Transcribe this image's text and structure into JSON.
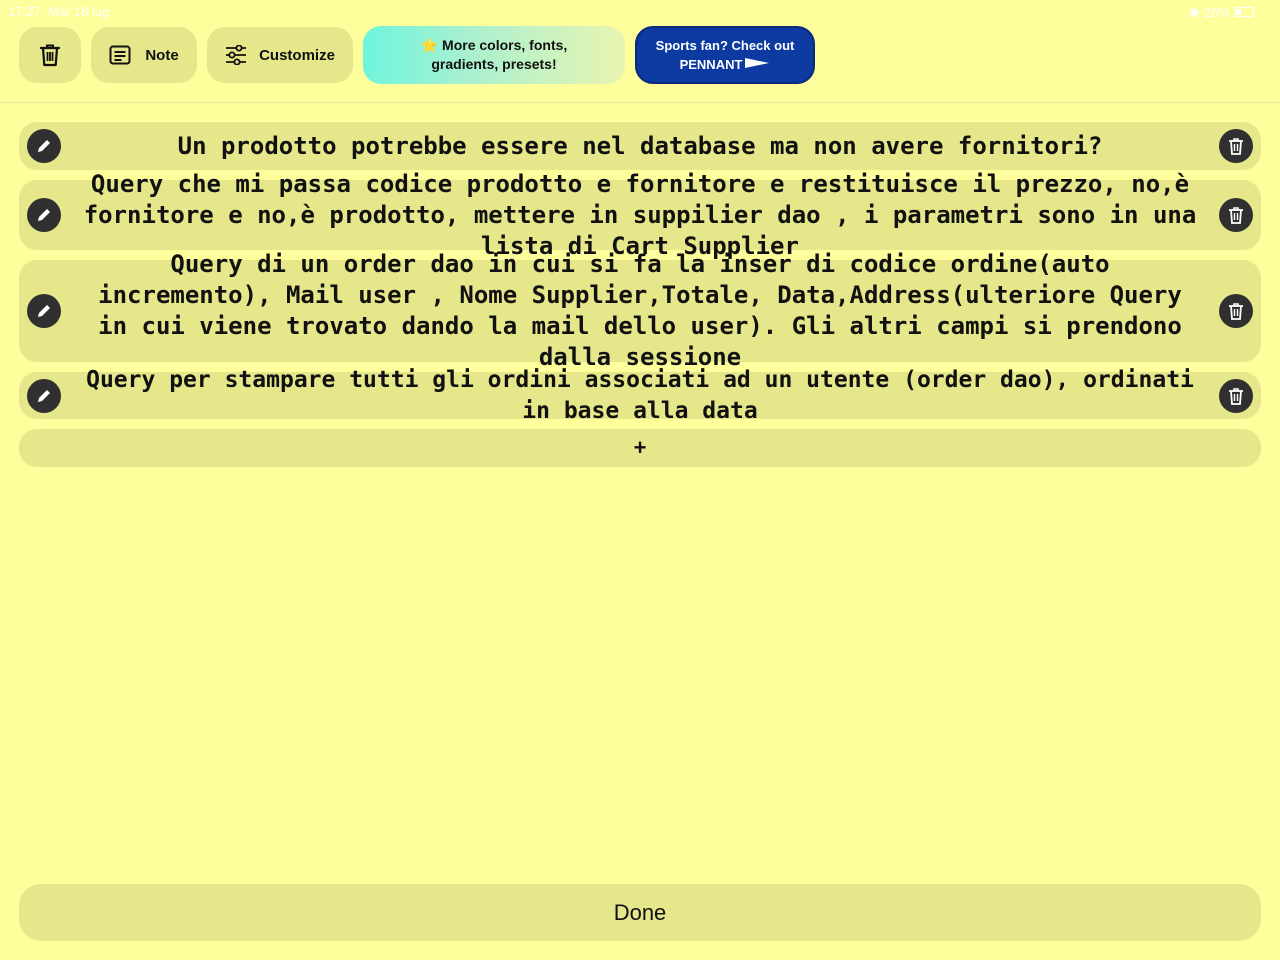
{
  "status_bar": {
    "time": "17:27",
    "date": "Mar 18 lug",
    "battery": "26%"
  },
  "toolbar": {
    "note_label": "Note",
    "customize_label": "Customize",
    "promo_line1": "More colors, fonts,",
    "promo_line2": "gradients, presets!",
    "pennant_line1": "Sports fan? Check out",
    "pennant_line2": "PENNANT"
  },
  "items": [
    {
      "text": "Un prodotto potrebbe essere nel database ma non avere fornitori?"
    },
    {
      "text": "Query che mi passa codice prodotto e fornitore e restituisce il prezzo, no,è fornitore e no,è prodotto, mettere in suppilier dao , i parametri sono in una lista di Cart Supplier"
    },
    {
      "text": "Query di un order dao in cui si fa la inser di codice ordine(auto incremento), Mail user , Nome Supplier,Totale, Data,Address(ulteriore Query in cui viene trovato dando la mail dello user). Gli altri campi si prendono dalla sessione"
    },
    {
      "text": "Query per stampare tutti gli ordini associati ad un utente (order dao), ordinati in base alla data"
    }
  ],
  "add_label": "+",
  "done_label": "Done",
  "colors": {
    "background": "#fefe9c",
    "card": "#e6e68a",
    "button_dark": "#303030",
    "pennant_blue": "#0d3aa0"
  },
  "icons": [
    "trash-icon",
    "note-icon",
    "sliders-icon",
    "star-icon",
    "pencil-icon",
    "pennant-flag-icon"
  ]
}
